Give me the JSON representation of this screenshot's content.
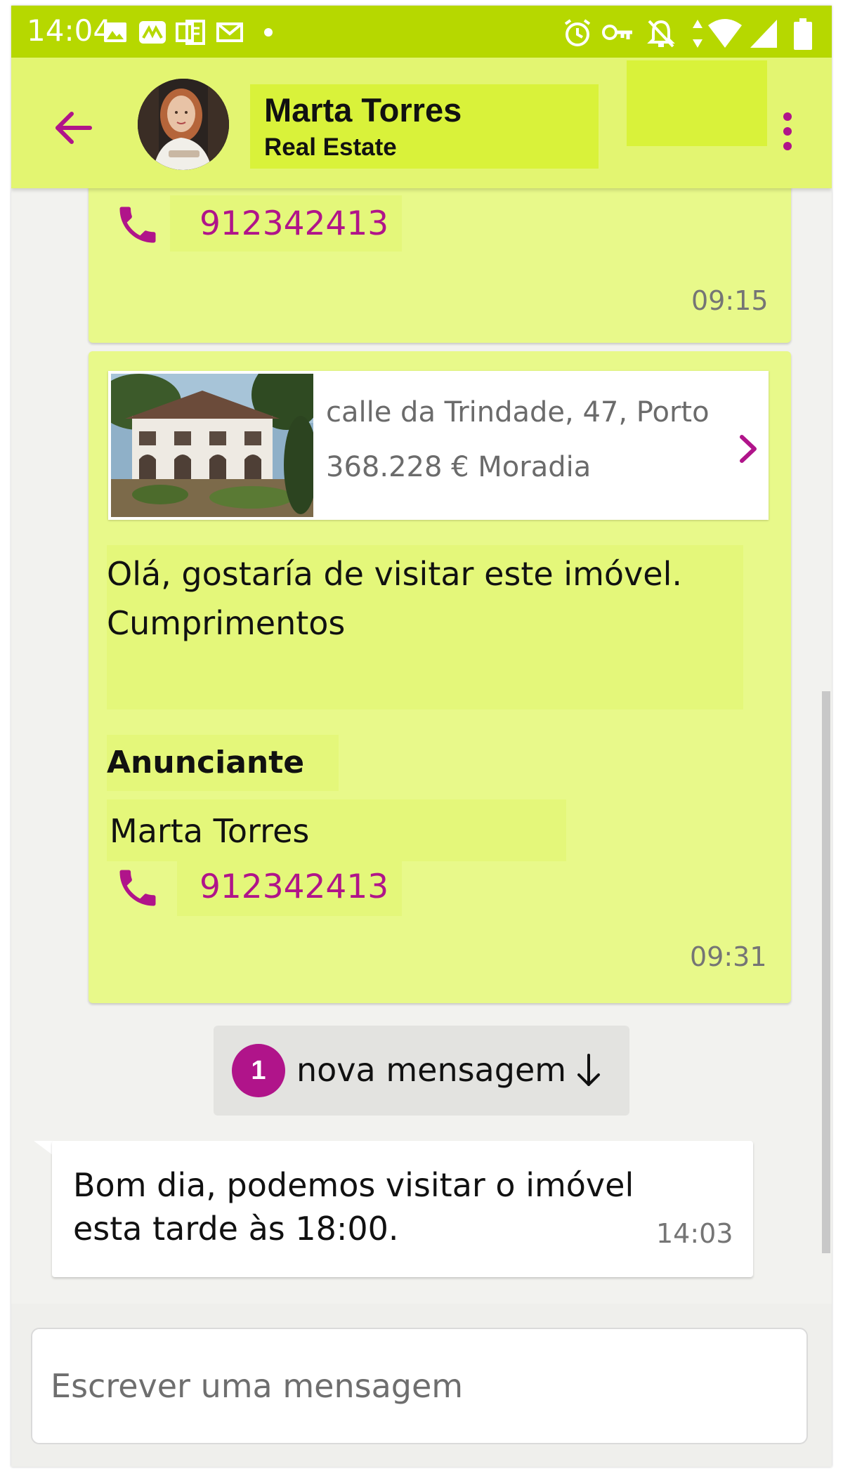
{
  "status_bar": {
    "time": "14:04",
    "left_icons": [
      "image-icon",
      "app-icon",
      "office-icon",
      "mail-icon",
      "dot-icon"
    ],
    "right_icons": [
      "alarm-icon",
      "key-icon",
      "bell-off-icon",
      "data-arrows-icon",
      "wifi-icon",
      "signal-icon",
      "battery-icon"
    ],
    "color": "#b6d800"
  },
  "header": {
    "contact_name": "Marta Torres",
    "contact_subtitle": "Real Estate",
    "accent": "#b0148a",
    "background": "#e3f571"
  },
  "messages": {
    "first": {
      "phone": "912342413",
      "time": "09:15"
    },
    "second": {
      "listing": {
        "address": "calle da Trindade, 47, Porto",
        "price_type": "368.228 € Moradia"
      },
      "text_line1": "Olá, gostaría de visitar este imóvel.",
      "text_line2": "Cumprimentos",
      "advertiser_label": "Anunciante",
      "advertiser_name": "Marta Torres",
      "phone": "912342413",
      "time": "09:31"
    },
    "new_indicator": {
      "count": "1",
      "label": "nova mensagem"
    },
    "incoming": {
      "text": "Bom dia, podemos visitar o imóvel esta tarde às 18:00.",
      "time": "14:03"
    }
  },
  "composer": {
    "placeholder": "Escrever uma mensagem"
  }
}
